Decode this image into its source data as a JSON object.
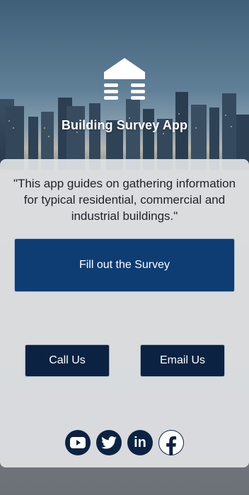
{
  "app": {
    "title": "Building Survey App",
    "tagline": "\"This app guides on gathering information for typical residential, commercial and industrial buildings.\""
  },
  "buttons": {
    "survey": "Fill out the Survey",
    "call": "Call Us",
    "email": "Email Us"
  },
  "socials": {
    "youtube": "youtube-icon",
    "twitter": "twitter-icon",
    "linkedin": "linkedin-icon",
    "facebook": "facebook-icon",
    "linkedin_text": "in"
  },
  "colors": {
    "primary_button": "#0e3d73",
    "dark_button": "#0b2242",
    "card_bg": "#e0e2e4"
  }
}
